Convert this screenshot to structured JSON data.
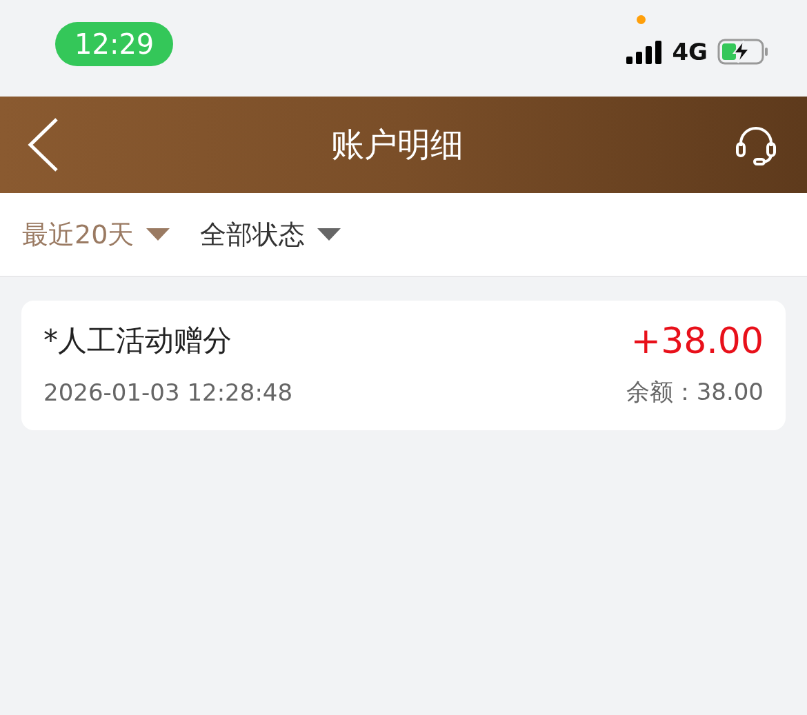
{
  "status_bar": {
    "time": "12:29",
    "network": "4G"
  },
  "header": {
    "title": "账户明细"
  },
  "filters": [
    {
      "label": "最近20天",
      "selected": true
    },
    {
      "label": "全部状态",
      "selected": false
    }
  ],
  "records": [
    {
      "title": "*人工活动赠分",
      "amount": "+38.00",
      "datetime": "2026-01-03 12:28:48",
      "balance": "余额：38.00"
    }
  ]
}
